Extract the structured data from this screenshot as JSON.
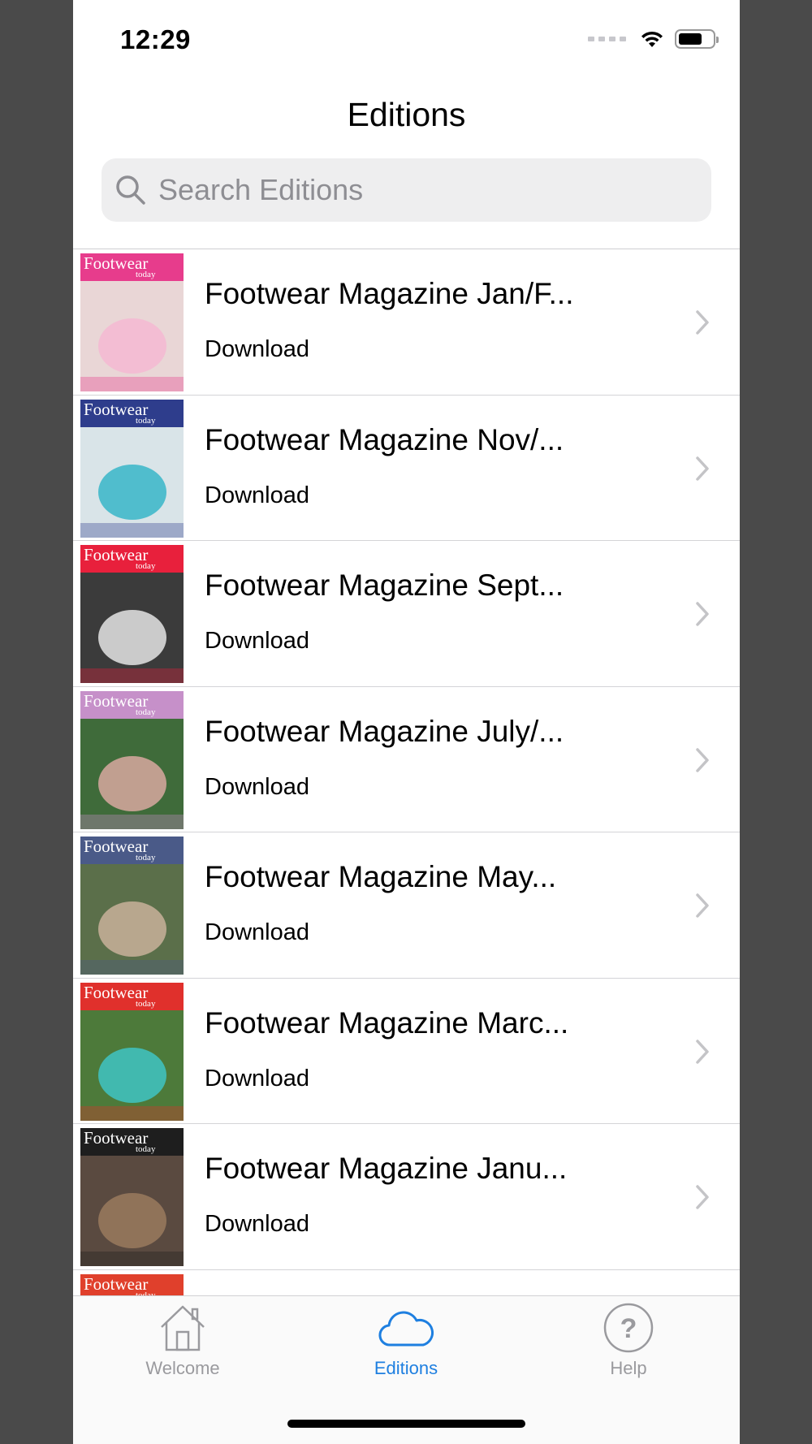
{
  "status_bar": {
    "time": "12:29"
  },
  "header": {
    "title": "Editions"
  },
  "search": {
    "placeholder": "Search Editions"
  },
  "editions": [
    {
      "title": "Footwear Magazine Jan/F...",
      "action": "Download",
      "cover_band": "#e73c8c",
      "cover_bg": "#e9d6d6",
      "cover_accent": "#f5b8d2"
    },
    {
      "title": "Footwear Magazine Nov/...",
      "action": "Download",
      "cover_band": "#2e3d8c",
      "cover_bg": "#d9e4e8",
      "cover_accent": "#37b6c8"
    },
    {
      "title": "Footwear Magazine Sept...",
      "action": "Download",
      "cover_band": "#e8203c",
      "cover_bg": "#3b3b3b",
      "cover_accent": "#e5e5e5"
    },
    {
      "title": "Footwear Magazine July/...",
      "action": "Download",
      "cover_band": "#c690c9",
      "cover_bg": "#3f6b3a",
      "cover_accent": "#d8a8a0"
    },
    {
      "title": "Footwear Magazine May...",
      "action": "Download",
      "cover_band": "#4a5a88",
      "cover_bg": "#5b6f4a",
      "cover_accent": "#c9b29a"
    },
    {
      "title": "Footwear Magazine Marc...",
      "action": "Download",
      "cover_band": "#e0302c",
      "cover_bg": "#4d7a3a",
      "cover_accent": "#40c4c4"
    },
    {
      "title": "Footwear Magazine Janu...",
      "action": "Download",
      "cover_band": "#1e1e1e",
      "cover_bg": "#5a4a40",
      "cover_accent": "#9a7a5e"
    },
    {
      "title": "",
      "action": "",
      "cover_band": "#e0402c",
      "cover_bg": "#cfa090",
      "cover_accent": "#e0402c"
    }
  ],
  "cover_masthead": "Footwear",
  "cover_masthead_sub": "today",
  "tabs": [
    {
      "label": "Welcome",
      "icon": "home-icon",
      "active": false
    },
    {
      "label": "Editions",
      "icon": "cloud-icon",
      "active": true
    },
    {
      "label": "Help",
      "icon": "help-icon",
      "active": false
    }
  ],
  "colors": {
    "accent": "#1e7fe0",
    "inactive": "#9a9a9e"
  }
}
